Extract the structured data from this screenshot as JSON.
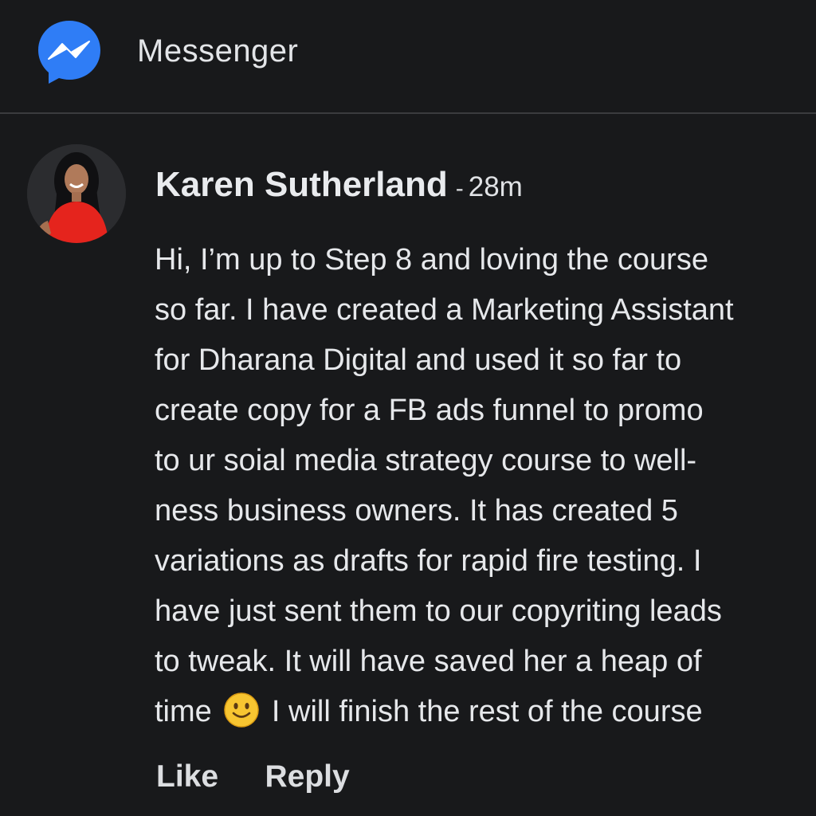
{
  "header": {
    "app_icon": "messenger-icon",
    "title": "Messenger"
  },
  "comment": {
    "author": "Karen Sutherland",
    "separator": "-",
    "timestamp": "28m",
    "body_lines": [
      "Hi, I’m up to Step 8 and loving the course",
      "so far. I have created a Marketing Assistant",
      "for Dharana Digital and used it so far to",
      "create copy for a FB ads funnel to promo",
      "to ur soial media strategy course to well-",
      "ness business owners. It has created 5",
      "variations as drafts for rapid fire testing. I",
      "have just sent them to our copyriting leads",
      "to tweak. It will have saved her a heap of"
    ],
    "last_line_before_emoji": "time",
    "emoji": "smiling-face-icon",
    "last_line_after_emoji": "I will finish the rest of the course",
    "actions": {
      "like_label": "Like",
      "reply_label": "Reply"
    }
  },
  "colors": {
    "background": "#18191b",
    "messenger_blue": "#2f7df6",
    "text": "#e6e8eb",
    "divider": "#3a3b3e"
  }
}
